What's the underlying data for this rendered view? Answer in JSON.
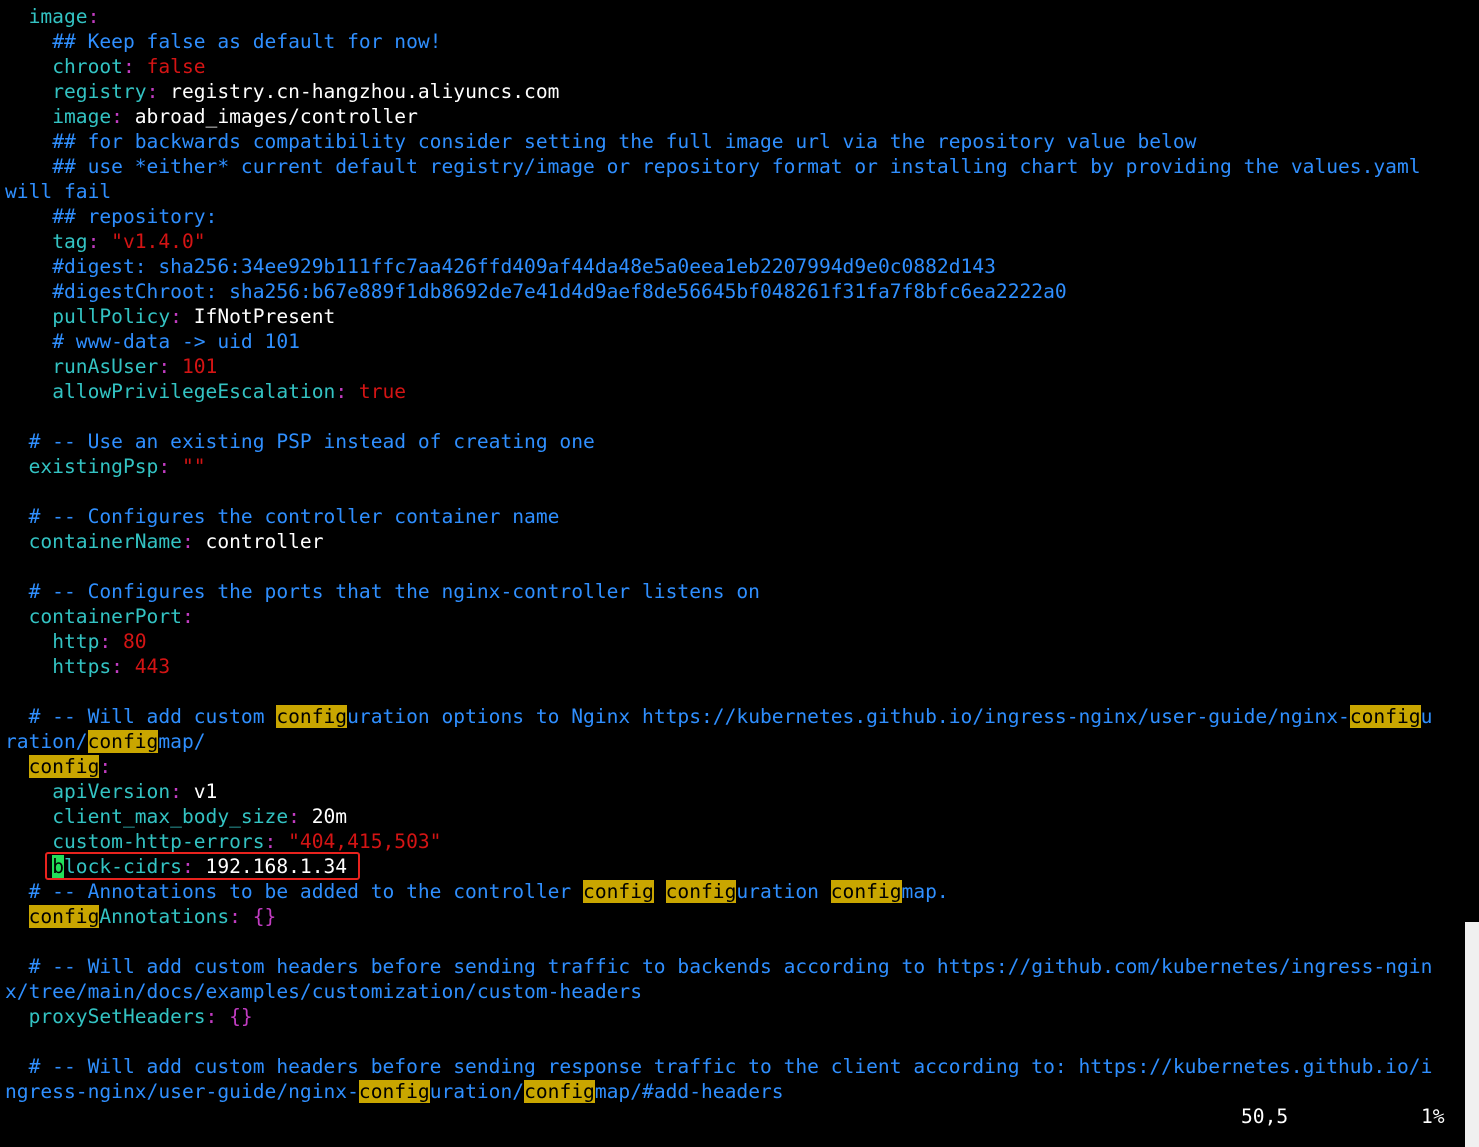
{
  "editor": {
    "lines": [
      [
        {
          "t": "  "
        },
        {
          "t": "image",
          "c": "k"
        },
        {
          "t": ":",
          "c": "m"
        }
      ],
      [
        {
          "t": "    "
        },
        {
          "t": "## Keep false as default for now!",
          "c": "c"
        }
      ],
      [
        {
          "t": "    "
        },
        {
          "t": "chroot",
          "c": "k"
        },
        {
          "t": ": ",
          "c": "m"
        },
        {
          "t": "false",
          "c": "r"
        }
      ],
      [
        {
          "t": "    "
        },
        {
          "t": "registry",
          "c": "k"
        },
        {
          "t": ": ",
          "c": "m"
        },
        {
          "t": "registry.cn-hangzhou.aliyuncs.com",
          "c": "w"
        }
      ],
      [
        {
          "t": "    "
        },
        {
          "t": "image",
          "c": "k"
        },
        {
          "t": ": ",
          "c": "m"
        },
        {
          "t": "abroad_images/controller",
          "c": "w"
        }
      ],
      [
        {
          "t": "    "
        },
        {
          "t": "## for backwards compatibility consider setting the full image url via the repository value below",
          "c": "c"
        }
      ],
      [
        {
          "t": "    "
        },
        {
          "t": "## use *either* current default registry/image or repository format or installing chart by providing the values.yaml",
          "c": "c"
        }
      ],
      [
        {
          "t": "will fail",
          "c": "c"
        }
      ],
      [
        {
          "t": "    "
        },
        {
          "t": "## repository:",
          "c": "c"
        }
      ],
      [
        {
          "t": "    "
        },
        {
          "t": "tag",
          "c": "k"
        },
        {
          "t": ": ",
          "c": "m"
        },
        {
          "t": "\"v1.4.0\"",
          "c": "r"
        }
      ],
      [
        {
          "t": "    "
        },
        {
          "t": "#digest: sha256:34ee929b111ffc7aa426ffd409af44da48e5a0eea1eb2207994d9e0c0882d143",
          "c": "c"
        }
      ],
      [
        {
          "t": "    "
        },
        {
          "t": "#digestChroot: sha256:b67e889f1db8692de7e41d4d9aef8de56645bf048261f31fa7f8bfc6ea2222a0",
          "c": "c"
        }
      ],
      [
        {
          "t": "    "
        },
        {
          "t": "pullPolicy",
          "c": "k"
        },
        {
          "t": ": ",
          "c": "m"
        },
        {
          "t": "IfNotPresent",
          "c": "w"
        }
      ],
      [
        {
          "t": "    "
        },
        {
          "t": "# www-data -> uid 101",
          "c": "c"
        }
      ],
      [
        {
          "t": "    "
        },
        {
          "t": "runAsUser",
          "c": "k"
        },
        {
          "t": ": ",
          "c": "m"
        },
        {
          "t": "101",
          "c": "r"
        }
      ],
      [
        {
          "t": "    "
        },
        {
          "t": "allowPrivilegeEscalation",
          "c": "k"
        },
        {
          "t": ": ",
          "c": "m"
        },
        {
          "t": "true",
          "c": "r"
        }
      ],
      [],
      [
        {
          "t": "  "
        },
        {
          "t": "# -- Use an existing PSP instead of creating one",
          "c": "c"
        }
      ],
      [
        {
          "t": "  "
        },
        {
          "t": "existingPsp",
          "c": "k"
        },
        {
          "t": ": ",
          "c": "m"
        },
        {
          "t": "\"\"",
          "c": "r"
        }
      ],
      [],
      [
        {
          "t": "  "
        },
        {
          "t": "# -- Configures the controller container name",
          "c": "c"
        }
      ],
      [
        {
          "t": "  "
        },
        {
          "t": "containerName",
          "c": "k"
        },
        {
          "t": ": ",
          "c": "m"
        },
        {
          "t": "controller",
          "c": "w"
        }
      ],
      [],
      [
        {
          "t": "  "
        },
        {
          "t": "# -- Configures the ports that the nginx-controller listens on",
          "c": "c"
        }
      ],
      [
        {
          "t": "  "
        },
        {
          "t": "containerPort",
          "c": "k"
        },
        {
          "t": ":",
          "c": "m"
        }
      ],
      [
        {
          "t": "    "
        },
        {
          "t": "http",
          "c": "k"
        },
        {
          "t": ": ",
          "c": "m"
        },
        {
          "t": "80",
          "c": "r"
        }
      ],
      [
        {
          "t": "    "
        },
        {
          "t": "https",
          "c": "k"
        },
        {
          "t": ": ",
          "c": "m"
        },
        {
          "t": "443",
          "c": "r"
        }
      ],
      [],
      [
        {
          "t": "  "
        },
        {
          "t": "# -- Will add custom ",
          "c": "c"
        },
        {
          "t": "config",
          "c": "hl"
        },
        {
          "t": "uration options to Nginx https://kubernetes.github.io/ingress-nginx/user-guide/nginx-",
          "c": "c"
        },
        {
          "t": "config",
          "c": "hl"
        },
        {
          "t": "u",
          "c": "c"
        }
      ],
      [
        {
          "t": "ration/",
          "c": "c"
        },
        {
          "t": "config",
          "c": "hl"
        },
        {
          "t": "map/",
          "c": "c"
        }
      ],
      [
        {
          "t": "  "
        },
        {
          "t": "config",
          "c": "hl"
        },
        {
          "t": ":",
          "c": "m"
        }
      ],
      [
        {
          "t": "    "
        },
        {
          "t": "apiVersion",
          "c": "k"
        },
        {
          "t": ": ",
          "c": "m"
        },
        {
          "t": "v1",
          "c": "w"
        }
      ],
      [
        {
          "t": "    "
        },
        {
          "t": "client_max_body_size",
          "c": "k"
        },
        {
          "t": ": ",
          "c": "m"
        },
        {
          "t": "20m",
          "c": "w"
        }
      ],
      [
        {
          "t": "    "
        },
        {
          "t": "custom-http-errors",
          "c": "k"
        },
        {
          "t": ": ",
          "c": "m"
        },
        {
          "t": "\"404,415,503\"",
          "c": "r"
        }
      ],
      [
        {
          "t": "    "
        },
        {
          "t": "b",
          "c": "cursor"
        },
        {
          "t": "lock-cidrs",
          "c": "k"
        },
        {
          "t": ": ",
          "c": "m"
        },
        {
          "t": "192.168.1.34",
          "c": "w"
        }
      ],
      [
        {
          "t": "  "
        },
        {
          "t": "# -- Annotations to be added to the controller ",
          "c": "c"
        },
        {
          "t": "config",
          "c": "hl"
        },
        {
          "t": " ",
          "c": "c"
        },
        {
          "t": "config",
          "c": "hl"
        },
        {
          "t": "uration ",
          "c": "c"
        },
        {
          "t": "config",
          "c": "hl"
        },
        {
          "t": "map.",
          "c": "c"
        }
      ],
      [
        {
          "t": "  "
        },
        {
          "t": "config",
          "c": "hl"
        },
        {
          "t": "Annotations",
          "c": "k"
        },
        {
          "t": ": {}",
          "c": "m"
        }
      ],
      [],
      [
        {
          "t": "  "
        },
        {
          "t": "# -- Will add custom headers before sending traffic to backends according to https://github.com/kubernetes/ingress-ngin",
          "c": "c"
        }
      ],
      [
        {
          "t": "x/tree/main/docs/examples/customization/custom-headers",
          "c": "c"
        }
      ],
      [
        {
          "t": "  "
        },
        {
          "t": "proxySetHeaders",
          "c": "k"
        },
        {
          "t": ": {}",
          "c": "m"
        }
      ],
      [],
      [
        {
          "t": "  "
        },
        {
          "t": "# -- Will add custom headers before sending response traffic to the client according to: https://kubernetes.github.io/i",
          "c": "c"
        }
      ],
      [
        {
          "t": "ngress-nginx/user-guide/nginx-",
          "c": "c"
        },
        {
          "t": "config",
          "c": "hl"
        },
        {
          "t": "uration/",
          "c": "c"
        },
        {
          "t": "config",
          "c": "hl"
        },
        {
          "t": "map/#add-headers",
          "c": "c"
        }
      ]
    ]
  },
  "status": {
    "cursor_position": "50,5",
    "scroll_percent": "1%"
  },
  "colors": {
    "background": "#000000",
    "key": "#33c3c3",
    "comment": "#2f8fff",
    "plain_value": "#ffffff",
    "literal": "#d41414",
    "punctuation": "#c23cc2",
    "search_highlight": "#c9a600",
    "cursor": "#22e05a",
    "annotation_box": "#e8231e"
  },
  "cursor_line": 34
}
